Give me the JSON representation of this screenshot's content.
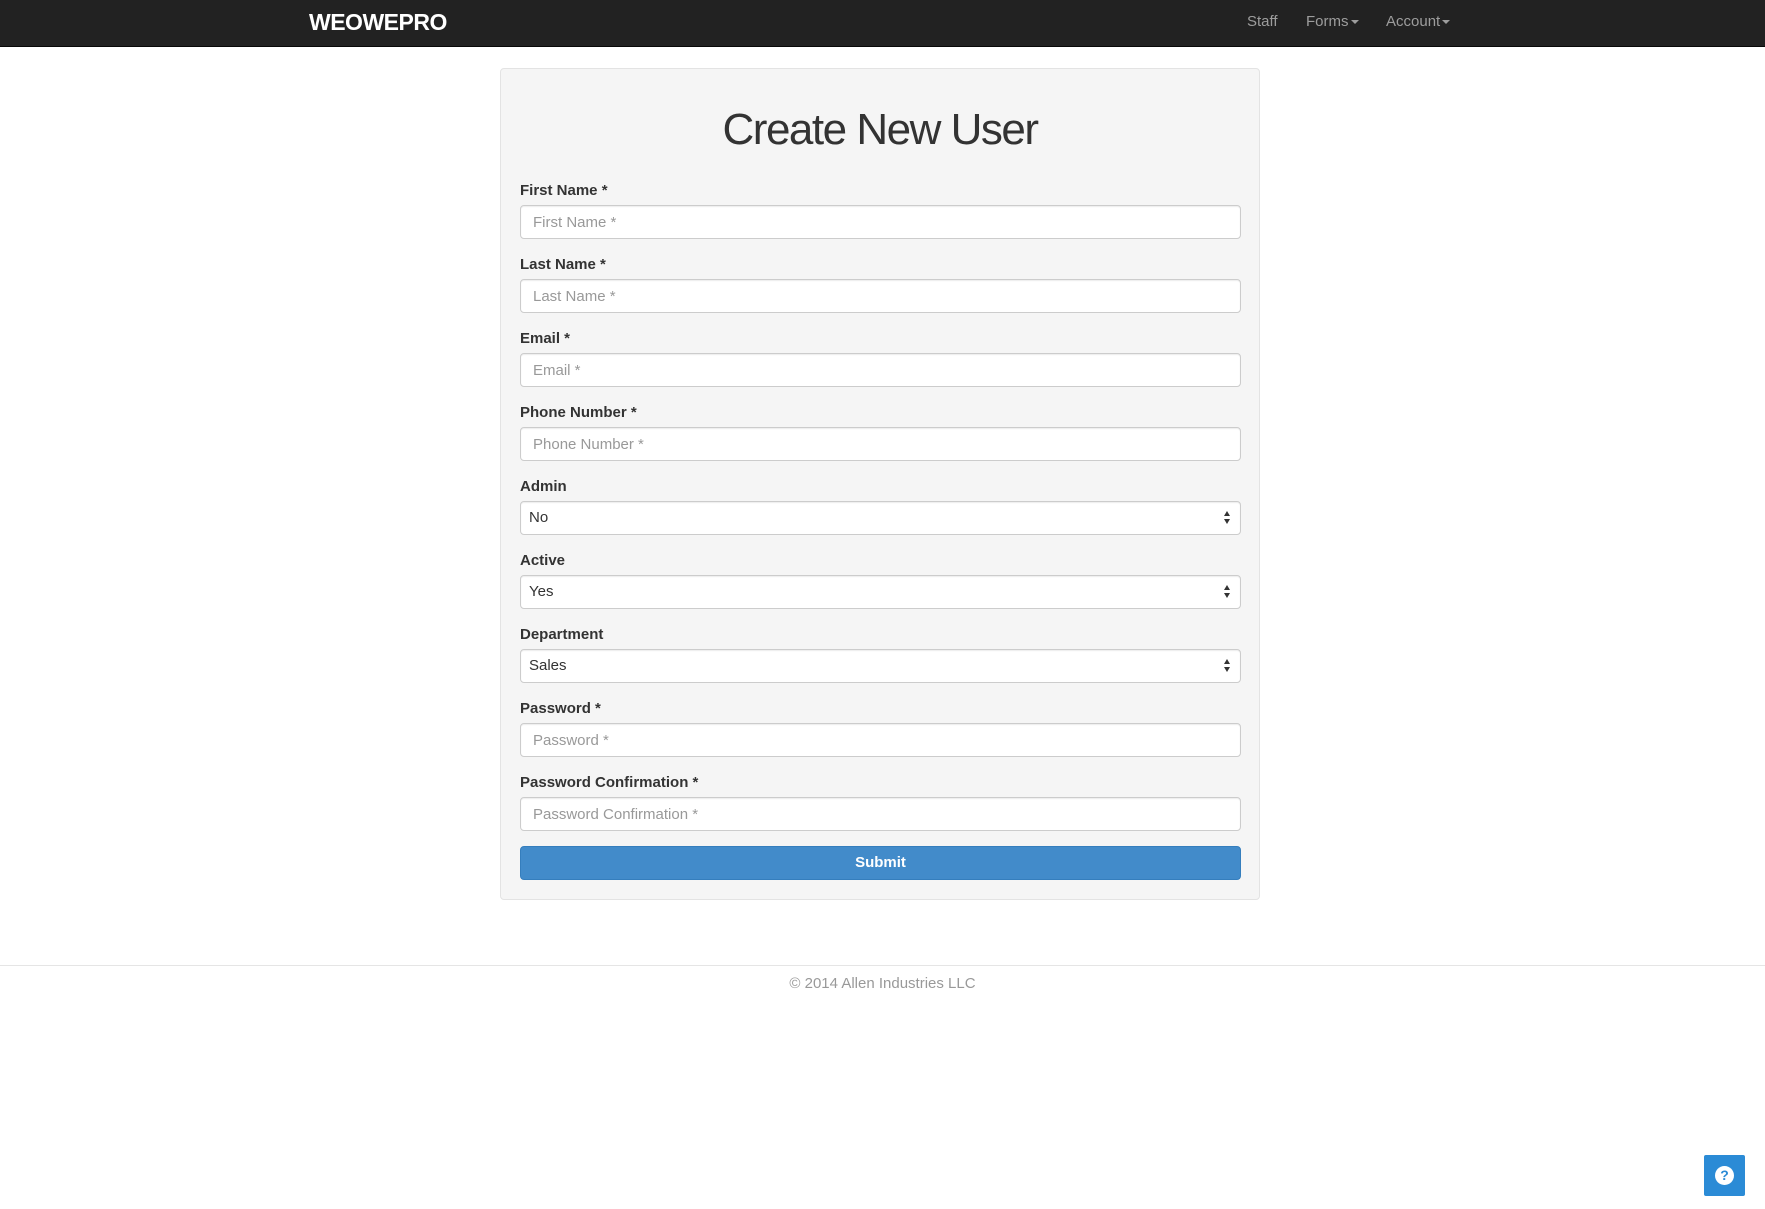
{
  "navbar": {
    "brand": "WEOWEPRO",
    "items": [
      {
        "label": "Staff",
        "dropdown": false
      },
      {
        "label": "Forms",
        "dropdown": true
      },
      {
        "label": "Account",
        "dropdown": true
      }
    ]
  },
  "form": {
    "title": "Create New User",
    "fields": {
      "first_name": {
        "label": "First Name *",
        "placeholder": "First Name *",
        "value": ""
      },
      "last_name": {
        "label": "Last Name *",
        "placeholder": "Last Name *",
        "value": ""
      },
      "email": {
        "label": "Email *",
        "placeholder": "Email *",
        "value": ""
      },
      "phone": {
        "label": "Phone Number *",
        "placeholder": "Phone Number *",
        "value": ""
      },
      "admin": {
        "label": "Admin",
        "selected": "No"
      },
      "active": {
        "label": "Active",
        "selected": "Yes"
      },
      "department": {
        "label": "Department",
        "selected": "Sales"
      },
      "password": {
        "label": "Password *",
        "placeholder": "Password *",
        "value": ""
      },
      "password_confirmation": {
        "label": "Password Confirmation *",
        "placeholder": "Password Confirmation *",
        "value": ""
      }
    },
    "submit_label": "Submit"
  },
  "footer": {
    "copyright": "© 2014 Allen Industries LLC"
  },
  "help": {
    "icon": "question-circle-icon",
    "glyph": "?"
  },
  "colors": {
    "navbar_bg": "#222222",
    "panel_bg": "#f5f5f5",
    "primary": "#428bca",
    "help_bg": "#2b8bd6"
  }
}
